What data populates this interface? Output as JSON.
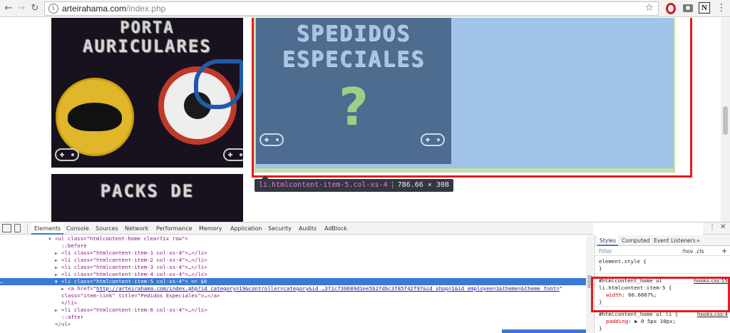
{
  "browser": {
    "back_icon": "arrow-left-icon",
    "forward_icon": "arrow-right-icon",
    "reload_icon": "reload-icon",
    "url_host": "arteirahama.com",
    "url_path": "/index.php",
    "info_glyph": "i",
    "extensions": [
      "opera-icon",
      "camera-icon",
      "notion-icon",
      "menu-icon"
    ],
    "ext_n_label": "N"
  },
  "page": {
    "tile1_line1": "PORTA",
    "tile1_line2": "AURICULARES",
    "tile2_line1": "PACKS DE",
    "special_line1": "SPEDIDOS",
    "special_line2": "ESPECIALES",
    "special_symbol": "?",
    "tooltip_selector": "li.htmlcontent-item-5.col-xs-4",
    "tooltip_size": "786.66 × 308",
    "highlight_color": "#e11b22",
    "special_bg": "#4e6b90",
    "item_bg": "#9fc4e8"
  },
  "devtools": {
    "tabs": [
      "Elements",
      "Console",
      "Sources",
      "Network",
      "Performance",
      "Memory",
      "Application",
      "Security",
      "Audits",
      "AdBlock"
    ],
    "active_tab": "Elements",
    "dom": {
      "ul_open": "<ul class=\"htmlcontent-home clearfix row\">",
      "before": "::before",
      "items": [
        "<li class=\"htmlcontent-item-1 col-xs-4\">…</li>",
        "<li class=\"htmlcontent-item-2 col-xs-4\">…</li>",
        "<li class=\"htmlcontent-item-3 col-xs-4\">…</li>",
        "<li class=\"htmlcontent-item-4 col-xs-4\">…</li>"
      ],
      "selected": "<li class=\"htmlcontent-item-5 col-xs-4\">",
      "selected_suffix": "== $0",
      "ellipsis": "…",
      "a_open": "<a href=\"",
      "a_href": "http://arteirahama.com/index.php?id_category=19&controller=category&id_…3f1c730689d1ee5b2fdbc3f85f42f97&id_shop=1&id_employee=1&theme=&theme_font=",
      "a_href_close": "\"",
      "a_class": "class=\"item-link\" title=\"Pedidos Especiales\">…</a>",
      "li_close": "</li>",
      "item6": "<li class=\"htmlcontent-item-6 col-xs-4\">…</li>",
      "after": "::after",
      "ul_close": "</ul>"
    },
    "styles": {
      "tabs": [
        "Styles",
        "Computed",
        "Event Listeners",
        "»"
      ],
      "filter_placeholder": "Filter",
      "filter_buttons": ":hov  .cls",
      "plus": "+",
      "rules": [
        {
          "selector": "element.style {",
          "decls": [],
          "close": "}",
          "source": ""
        },
        {
          "selector": "#htmlcontent_home ul",
          "selector2": "li.htmlcontent-item-5 {",
          "source": "hooks.css:15",
          "decls": [
            {
              "prop": "width",
              "val": "66.6667%;"
            }
          ],
          "close": "}"
        },
        {
          "selector": "#htmlcontent_home ul li {",
          "source": "hooks.css:4",
          "decls": [
            {
              "prop": "padding",
              "val": "▶ 0 5px 10px;"
            }
          ],
          "close": "}"
        }
      ]
    },
    "right_icons": [
      "⋮",
      "✕"
    ]
  }
}
